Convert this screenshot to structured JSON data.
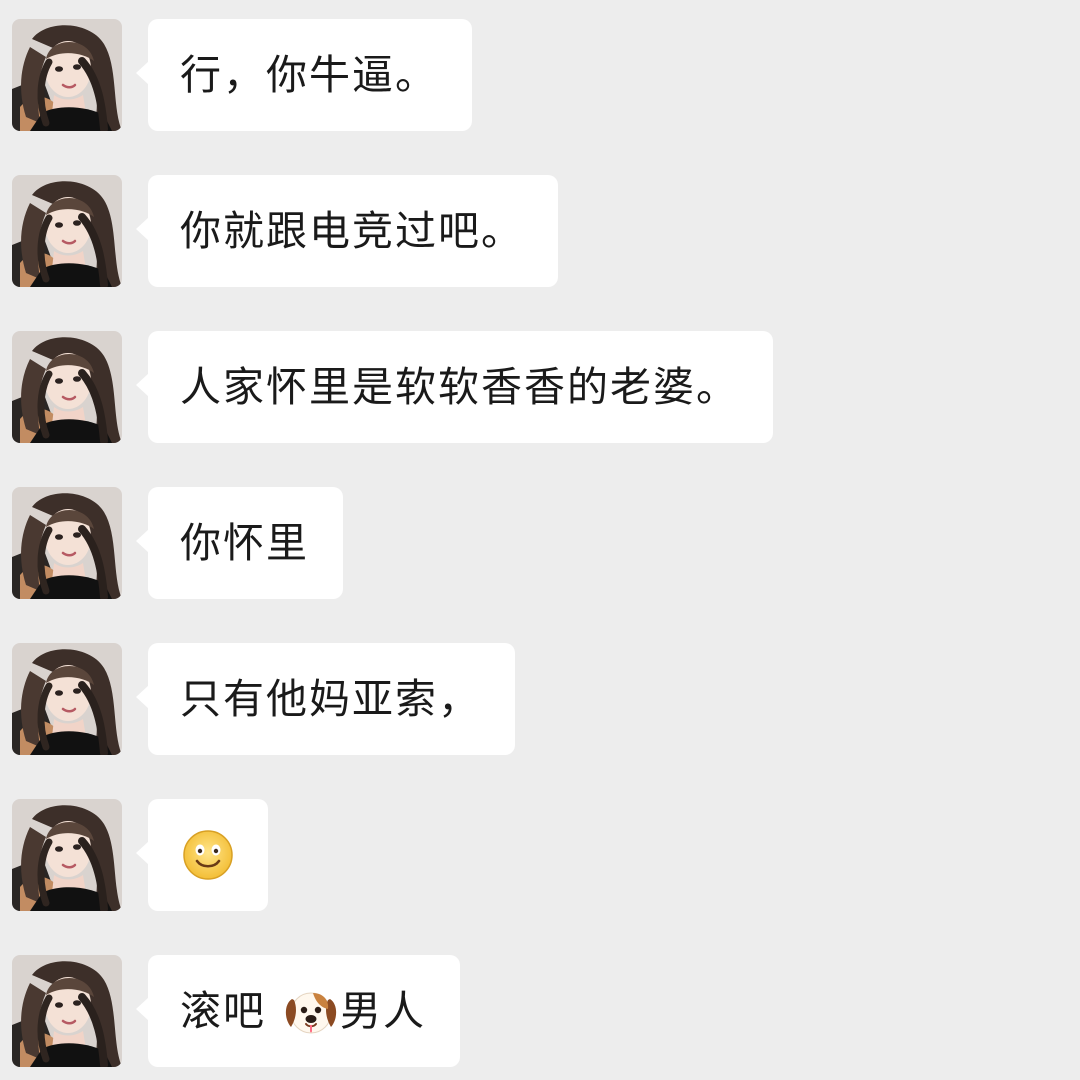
{
  "messages": [
    {
      "text": "行，你牛逼。"
    },
    {
      "text": "你就跟电竞过吧。"
    },
    {
      "text": "人家怀里是软软香香的老婆。"
    },
    {
      "text": "你怀里"
    },
    {
      "text": "只有他妈亚索，"
    },
    {
      "emoji": "smile-emoji"
    },
    {
      "text_before": "滚吧",
      "emoji": "dog-emoji",
      "text_after": "男人"
    }
  ],
  "colors": {
    "background": "#ededed",
    "bubble": "#ffffff",
    "text": "#1a1a1a"
  }
}
